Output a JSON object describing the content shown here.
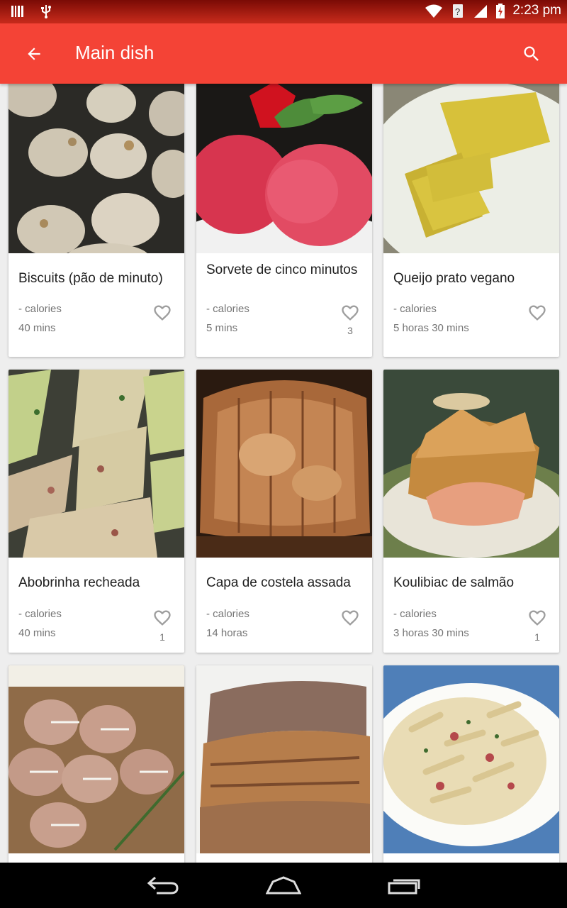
{
  "status_bar": {
    "time": "2:23 pm",
    "icons": [
      "barcode-icon",
      "usb-icon",
      "wifi-icon",
      "unknown-sim-icon",
      "signal-icon",
      "battery-charging-icon"
    ]
  },
  "app_bar": {
    "title": "Main dish",
    "back_icon": "arrow-back-icon",
    "search_icon": "search-icon"
  },
  "recipes": [
    {
      "name": "Biscuits (pão de minuto)",
      "calories": "- calories",
      "time": "40 mins",
      "likes": ""
    },
    {
      "name": "Sorvete de cinco minutos",
      "calories": "- calories",
      "time": "5 mins",
      "likes": "3"
    },
    {
      "name": "Queijo prato vegano",
      "calories": "- calories",
      "time": "5 horas 30 mins",
      "likes": ""
    },
    {
      "name": "Abobrinha recheada",
      "calories": "- calories",
      "time": "40 mins",
      "likes": "1"
    },
    {
      "name": "Capa de costela assada",
      "calories": "- calories",
      "time": "14 horas",
      "likes": ""
    },
    {
      "name": "Koulibiac de salmão",
      "calories": "- calories",
      "time": "3 horas 30 mins",
      "likes": "1"
    }
  ],
  "colors": {
    "primary": "#f44336",
    "status_bar": "#c92b1c",
    "text_primary": "#212121",
    "text_secondary": "#757575"
  },
  "nav_bar": {
    "icons": [
      "back-nav-icon",
      "home-nav-icon",
      "recents-nav-icon"
    ]
  }
}
